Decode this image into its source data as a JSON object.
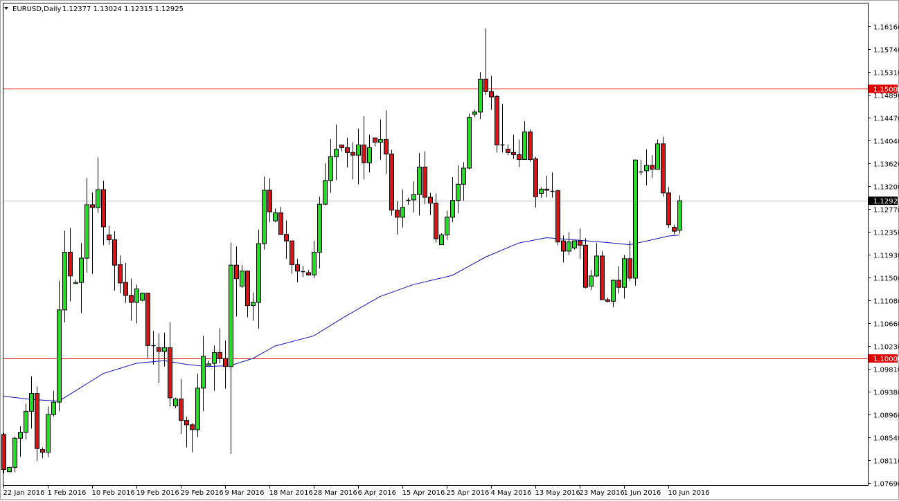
{
  "chart_data": {
    "type": "candlestick",
    "title": {
      "symbol": "EURUSD,Daily",
      "ohlc": "1.12377 1.13024 1.12315 1.12925"
    },
    "ylim": [
      1.0769,
      1.1616
    ],
    "y_ticks": [
      "1.16160",
      "1.15740",
      "1.15310",
      "1.14890",
      "1.14470",
      "1.14040",
      "1.13620",
      "1.13200",
      "1.12770",
      "1.12350",
      "1.11930",
      "1.11500",
      "1.11080",
      "1.10660",
      "1.10230",
      "1.09810",
      "1.09380",
      "1.08960",
      "1.08540",
      "1.08110",
      "1.07690"
    ],
    "y_tick_values": [
      1.1616,
      1.1574,
      1.1531,
      1.1489,
      1.1447,
      1.1404,
      1.1362,
      1.132,
      1.1277,
      1.1235,
      1.1193,
      1.115,
      1.1108,
      1.1066,
      1.1023,
      1.0981,
      1.0938,
      1.0896,
      1.0854,
      1.0811,
      1.0769
    ],
    "x_ticks": [
      "22 Jan 2016",
      "1 Feb 2016",
      "10 Feb 2016",
      "19 Feb 2016",
      "29 Feb 2016",
      "9 Mar 2016",
      "18 Mar 2016",
      "28 Mar 2016",
      "6 Apr 2016",
      "15 Apr 2016",
      "25 Apr 2016",
      "4 May 2016",
      "13 May 2016",
      "23 May 2016",
      "1 Jun 2016",
      "10 Jun 2016"
    ],
    "x_tick_every_n_candles": 8,
    "horizontal_levels": [
      {
        "price": 1.15,
        "label": "1.15000",
        "color": "#e00000"
      },
      {
        "price": 1.1,
        "label": "1.10000",
        "color": "#e00000"
      }
    ],
    "current_price": {
      "price": 1.12925,
      "label": "1.12925",
      "line_color": "#c0c0c0"
    },
    "colors": {
      "up": "#22dd22",
      "down": "#dd1111",
      "ma": "#1010c0"
    },
    "candles_ohlc": [
      [
        1.0859,
        1.0862,
        1.0787,
        1.0794
      ],
      [
        1.079,
        1.0799,
        1.0789,
        1.0798
      ],
      [
        1.0798,
        1.0855,
        1.0789,
        1.0852
      ],
      [
        1.0852,
        1.0874,
        1.0818,
        1.0863
      ],
      [
        1.0863,
        1.0916,
        1.085,
        1.0902
      ],
      [
        1.0902,
        1.0967,
        1.087,
        1.0935
      ],
      [
        1.0935,
        1.0948,
        1.081,
        1.0833
      ],
      [
        1.0831,
        1.0835,
        1.0815,
        1.0826
      ],
      [
        1.0826,
        1.0911,
        1.0817,
        1.0896
      ],
      [
        1.0896,
        1.094,
        1.0892,
        1.0919
      ],
      [
        1.0919,
        1.1144,
        1.0902,
        1.109
      ],
      [
        1.109,
        1.1237,
        1.1067,
        1.1197
      ],
      [
        1.1197,
        1.1242,
        1.1106,
        1.1153
      ],
      [
        1.1139,
        1.1146,
        1.1139,
        1.1141
      ],
      [
        1.1141,
        1.1214,
        1.1084,
        1.1186
      ],
      [
        1.1186,
        1.1335,
        1.1159,
        1.1285
      ],
      [
        1.1285,
        1.1308,
        1.1157,
        1.128
      ],
      [
        1.128,
        1.1373,
        1.127,
        1.1313
      ],
      [
        1.1313,
        1.133,
        1.121,
        1.1244
      ],
      [
        1.1229,
        1.1246,
        1.1211,
        1.122
      ],
      [
        1.122,
        1.1236,
        1.1126,
        1.1173
      ],
      [
        1.1174,
        1.1191,
        1.1121,
        1.114
      ],
      [
        1.1141,
        1.1177,
        1.1103,
        1.1117
      ],
      [
        1.1117,
        1.1148,
        1.107,
        1.1104
      ],
      [
        1.1104,
        1.1137,
        1.1065,
        1.1129
      ],
      [
        1.1108,
        1.1122,
        1.1106,
        1.1121
      ],
      [
        1.1121,
        1.1122,
        1.1001,
        1.1024
      ],
      [
        1.1024,
        1.1051,
        1.0989,
        1.1023
      ],
      [
        1.102,
        1.1046,
        1.0955,
        1.1013
      ],
      [
        1.1013,
        1.1048,
        1.0985,
        1.102
      ],
      [
        1.102,
        1.1067,
        1.0911,
        1.0927
      ],
      [
        1.0912,
        1.0927,
        1.0908,
        1.0925
      ],
      [
        1.0925,
        1.0962,
        1.086,
        1.0885
      ],
      [
        1.0885,
        1.0892,
        1.0835,
        1.0877
      ],
      [
        1.0877,
        1.088,
        1.0826,
        1.0868
      ],
      [
        1.0868,
        1.0972,
        1.0854,
        1.0945
      ],
      [
        1.0945,
        1.1042,
        1.0902,
        1.1004
      ],
      [
        1.0987,
        1.0996,
        1.0987,
        1.099
      ],
      [
        1.0991,
        1.1024,
        1.094,
        1.1011
      ],
      [
        1.1011,
        1.1056,
        1.0991,
        1.1
      ],
      [
        1.1,
        1.1033,
        1.0944,
        1.0985
      ],
      [
        1.0985,
        1.1215,
        1.0823,
        1.1173
      ],
      [
        1.1173,
        1.1208,
        1.1078,
        1.1148
      ],
      [
        1.1134,
        1.1173,
        1.1131,
        1.1162
      ],
      [
        1.1162,
        1.1163,
        1.1076,
        1.1098
      ],
      [
        1.1098,
        1.1122,
        1.107,
        1.1104
      ],
      [
        1.1104,
        1.1239,
        1.1055,
        1.1213
      ],
      [
        1.1213,
        1.1337,
        1.1202,
        1.1312
      ],
      [
        1.1312,
        1.1334,
        1.1253,
        1.1272
      ],
      [
        1.1255,
        1.1278,
        1.1253,
        1.127
      ],
      [
        1.127,
        1.1281,
        1.123,
        1.123
      ],
      [
        1.123,
        1.1256,
        1.1185,
        1.1218
      ],
      [
        1.1218,
        1.1218,
        1.1157,
        1.1174
      ],
      [
        1.1174,
        1.1185,
        1.1141,
        1.1162
      ],
      [
        1.1162,
        1.1172,
        1.1151,
        1.1161
      ],
      [
        1.1159,
        1.1164,
        1.1154,
        1.1155
      ],
      [
        1.1155,
        1.1218,
        1.1149,
        1.1197
      ],
      [
        1.1197,
        1.13,
        1.1167,
        1.1286
      ],
      [
        1.1286,
        1.1362,
        1.1284,
        1.133
      ],
      [
        1.133,
        1.1407,
        1.1307,
        1.1374
      ],
      [
        1.1374,
        1.1434,
        1.1331,
        1.1388
      ],
      [
        1.1396,
        1.1396,
        1.1384,
        1.1391
      ],
      [
        1.1391,
        1.1409,
        1.1354,
        1.1382
      ],
      [
        1.1382,
        1.1401,
        1.1332,
        1.1377
      ],
      [
        1.1377,
        1.1426,
        1.1323,
        1.1396
      ],
      [
        1.1396,
        1.1449,
        1.1332,
        1.1363
      ],
      [
        1.1363,
        1.1415,
        1.1345,
        1.1391
      ],
      [
        1.1409,
        1.1409,
        1.1393,
        1.1401
      ],
      [
        1.1401,
        1.1443,
        1.1368,
        1.1406
      ],
      [
        1.1406,
        1.146,
        1.1342,
        1.1379
      ],
      [
        1.1379,
        1.1387,
        1.1265,
        1.1275
      ],
      [
        1.1275,
        1.1292,
        1.123,
        1.1262
      ],
      [
        1.1262,
        1.1313,
        1.1243,
        1.128
      ],
      [
        1.1293,
        1.1298,
        1.1285,
        1.1294
      ],
      [
        1.1294,
        1.1328,
        1.1271,
        1.1304
      ],
      [
        1.1304,
        1.1381,
        1.1265,
        1.1355
      ],
      [
        1.1355,
        1.1384,
        1.1286,
        1.1299
      ],
      [
        1.1299,
        1.1307,
        1.1266,
        1.1288
      ],
      [
        1.1288,
        1.1306,
        1.1215,
        1.1222
      ],
      [
        1.1211,
        1.1232,
        1.1211,
        1.1229
      ],
      [
        1.1229,
        1.1274,
        1.122,
        1.1262
      ],
      [
        1.1262,
        1.1336,
        1.1253,
        1.1293
      ],
      [
        1.1293,
        1.1358,
        1.1269,
        1.1323
      ],
      [
        1.1323,
        1.1364,
        1.1293,
        1.1353
      ],
      [
        1.1353,
        1.1454,
        1.1351,
        1.1447
      ],
      [
        1.1453,
        1.1461,
        1.1448,
        1.1457
      ],
      [
        1.1457,
        1.1531,
        1.1444,
        1.1518
      ],
      [
        1.1518,
        1.1612,
        1.1489,
        1.1495
      ],
      [
        1.1495,
        1.1524,
        1.1461,
        1.1485
      ],
      [
        1.1486,
        1.1489,
        1.1382,
        1.1396
      ],
      [
        1.1396,
        1.1472,
        1.1382,
        1.1396
      ],
      [
        1.1388,
        1.1397,
        1.1377,
        1.1382
      ],
      [
        1.1382,
        1.1415,
        1.137,
        1.1378
      ],
      [
        1.1378,
        1.1406,
        1.1355,
        1.1369
      ],
      [
        1.1369,
        1.144,
        1.1369,
        1.142
      ],
      [
        1.142,
        1.1425,
        1.1365,
        1.1369
      ],
      [
        1.137,
        1.1374,
        1.128,
        1.13
      ],
      [
        1.1306,
        1.1317,
        1.1298,
        1.1314
      ],
      [
        1.1314,
        1.1339,
        1.1299,
        1.1312
      ],
      [
        1.1311,
        1.1345,
        1.1298,
        1.1311
      ],
      [
        1.1311,
        1.1313,
        1.121,
        1.1216
      ],
      [
        1.1218,
        1.1228,
        1.1178,
        1.1199
      ],
      [
        1.1199,
        1.1234,
        1.1192,
        1.1216
      ],
      [
        1.1205,
        1.1218,
        1.1202,
        1.1218
      ],
      [
        1.1218,
        1.1241,
        1.1185,
        1.121
      ],
      [
        1.121,
        1.1223,
        1.113,
        1.1132
      ],
      [
        1.1134,
        1.1164,
        1.1127,
        1.1153
      ],
      [
        1.1153,
        1.1214,
        1.1151,
        1.119
      ],
      [
        1.119,
        1.1199,
        1.1109,
        1.1109
      ],
      [
        1.1109,
        1.1113,
        1.1104,
        1.1106
      ],
      [
        1.1106,
        1.1146,
        1.1095,
        1.1145
      ],
      [
        1.1145,
        1.1171,
        1.1121,
        1.1132
      ],
      [
        1.1132,
        1.1192,
        1.1111,
        1.1185
      ],
      [
        1.1185,
        1.1218,
        1.1144,
        1.1149
      ],
      [
        1.1149,
        1.1369,
        1.1135,
        1.1368
      ],
      [
        1.1346,
        1.1368,
        1.134,
        1.1346
      ],
      [
        1.1348,
        1.1388,
        1.1321,
        1.1358
      ],
      [
        1.1358,
        1.1377,
        1.1335,
        1.1351
      ],
      [
        1.1351,
        1.1406,
        1.135,
        1.1398
      ],
      [
        1.1398,
        1.1411,
        1.13,
        1.1307
      ],
      [
        1.1307,
        1.1318,
        1.1242,
        1.1248
      ],
      [
        1.1243,
        1.1248,
        1.123,
        1.1236
      ],
      [
        1.12377,
        1.13024,
        1.12315,
        1.12925
      ]
    ],
    "moving_average": [
      [
        0,
        1.093
      ],
      [
        5,
        1.0924
      ],
      [
        10,
        1.0921
      ],
      [
        13,
        1.094
      ],
      [
        18,
        1.0972
      ],
      [
        24,
        1.0991
      ],
      [
        29,
        1.0996
      ],
      [
        33,
        1.0989
      ],
      [
        37,
        1.0985
      ],
      [
        41,
        1.0987
      ],
      [
        45,
        1.1
      ],
      [
        49,
        1.1023
      ],
      [
        56,
        1.1042
      ],
      [
        62,
        1.108
      ],
      [
        68,
        1.1115
      ],
      [
        74,
        1.1137
      ],
      [
        81,
        1.1154
      ],
      [
        87,
        1.1188
      ],
      [
        93,
        1.1214
      ],
      [
        98,
        1.1224
      ],
      [
        103,
        1.122
      ],
      [
        108,
        1.1216
      ],
      [
        113,
        1.1211
      ],
      [
        117,
        1.122
      ],
      [
        120,
        1.1227
      ],
      [
        122,
        1.1229
      ]
    ]
  }
}
